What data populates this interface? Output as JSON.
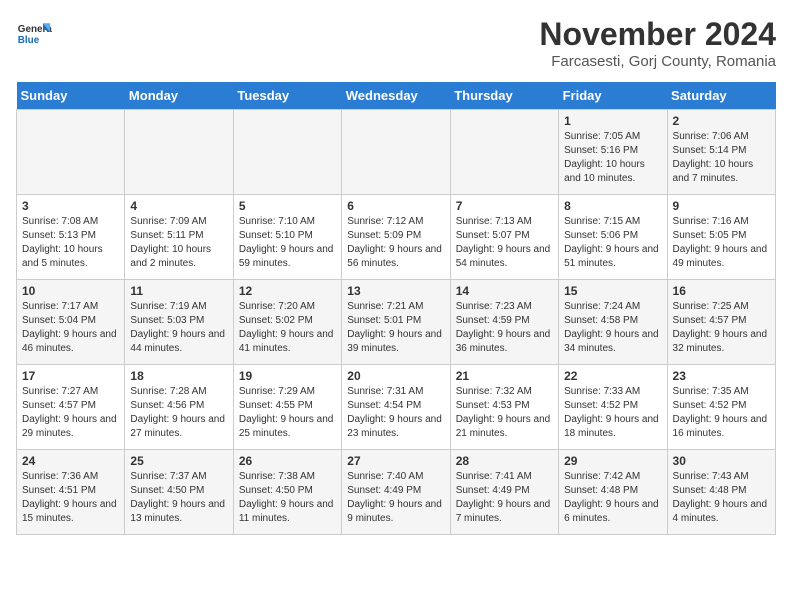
{
  "logo": {
    "text_general": "General",
    "text_blue": "Blue"
  },
  "header": {
    "month_year": "November 2024",
    "location": "Farcasesti, Gorj County, Romania"
  },
  "weekdays": [
    "Sunday",
    "Monday",
    "Tuesday",
    "Wednesday",
    "Thursday",
    "Friday",
    "Saturday"
  ],
  "weeks": [
    [
      {
        "day": "",
        "info": ""
      },
      {
        "day": "",
        "info": ""
      },
      {
        "day": "",
        "info": ""
      },
      {
        "day": "",
        "info": ""
      },
      {
        "day": "",
        "info": ""
      },
      {
        "day": "1",
        "info": "Sunrise: 7:05 AM\nSunset: 5:16 PM\nDaylight: 10 hours and 10 minutes."
      },
      {
        "day": "2",
        "info": "Sunrise: 7:06 AM\nSunset: 5:14 PM\nDaylight: 10 hours and 7 minutes."
      }
    ],
    [
      {
        "day": "3",
        "info": "Sunrise: 7:08 AM\nSunset: 5:13 PM\nDaylight: 10 hours and 5 minutes."
      },
      {
        "day": "4",
        "info": "Sunrise: 7:09 AM\nSunset: 5:11 PM\nDaylight: 10 hours and 2 minutes."
      },
      {
        "day": "5",
        "info": "Sunrise: 7:10 AM\nSunset: 5:10 PM\nDaylight: 9 hours and 59 minutes."
      },
      {
        "day": "6",
        "info": "Sunrise: 7:12 AM\nSunset: 5:09 PM\nDaylight: 9 hours and 56 minutes."
      },
      {
        "day": "7",
        "info": "Sunrise: 7:13 AM\nSunset: 5:07 PM\nDaylight: 9 hours and 54 minutes."
      },
      {
        "day": "8",
        "info": "Sunrise: 7:15 AM\nSunset: 5:06 PM\nDaylight: 9 hours and 51 minutes."
      },
      {
        "day": "9",
        "info": "Sunrise: 7:16 AM\nSunset: 5:05 PM\nDaylight: 9 hours and 49 minutes."
      }
    ],
    [
      {
        "day": "10",
        "info": "Sunrise: 7:17 AM\nSunset: 5:04 PM\nDaylight: 9 hours and 46 minutes."
      },
      {
        "day": "11",
        "info": "Sunrise: 7:19 AM\nSunset: 5:03 PM\nDaylight: 9 hours and 44 minutes."
      },
      {
        "day": "12",
        "info": "Sunrise: 7:20 AM\nSunset: 5:02 PM\nDaylight: 9 hours and 41 minutes."
      },
      {
        "day": "13",
        "info": "Sunrise: 7:21 AM\nSunset: 5:01 PM\nDaylight: 9 hours and 39 minutes."
      },
      {
        "day": "14",
        "info": "Sunrise: 7:23 AM\nSunset: 4:59 PM\nDaylight: 9 hours and 36 minutes."
      },
      {
        "day": "15",
        "info": "Sunrise: 7:24 AM\nSunset: 4:58 PM\nDaylight: 9 hours and 34 minutes."
      },
      {
        "day": "16",
        "info": "Sunrise: 7:25 AM\nSunset: 4:57 PM\nDaylight: 9 hours and 32 minutes."
      }
    ],
    [
      {
        "day": "17",
        "info": "Sunrise: 7:27 AM\nSunset: 4:57 PM\nDaylight: 9 hours and 29 minutes."
      },
      {
        "day": "18",
        "info": "Sunrise: 7:28 AM\nSunset: 4:56 PM\nDaylight: 9 hours and 27 minutes."
      },
      {
        "day": "19",
        "info": "Sunrise: 7:29 AM\nSunset: 4:55 PM\nDaylight: 9 hours and 25 minutes."
      },
      {
        "day": "20",
        "info": "Sunrise: 7:31 AM\nSunset: 4:54 PM\nDaylight: 9 hours and 23 minutes."
      },
      {
        "day": "21",
        "info": "Sunrise: 7:32 AM\nSunset: 4:53 PM\nDaylight: 9 hours and 21 minutes."
      },
      {
        "day": "22",
        "info": "Sunrise: 7:33 AM\nSunset: 4:52 PM\nDaylight: 9 hours and 18 minutes."
      },
      {
        "day": "23",
        "info": "Sunrise: 7:35 AM\nSunset: 4:52 PM\nDaylight: 9 hours and 16 minutes."
      }
    ],
    [
      {
        "day": "24",
        "info": "Sunrise: 7:36 AM\nSunset: 4:51 PM\nDaylight: 9 hours and 15 minutes."
      },
      {
        "day": "25",
        "info": "Sunrise: 7:37 AM\nSunset: 4:50 PM\nDaylight: 9 hours and 13 minutes."
      },
      {
        "day": "26",
        "info": "Sunrise: 7:38 AM\nSunset: 4:50 PM\nDaylight: 9 hours and 11 minutes."
      },
      {
        "day": "27",
        "info": "Sunrise: 7:40 AM\nSunset: 4:49 PM\nDaylight: 9 hours and 9 minutes."
      },
      {
        "day": "28",
        "info": "Sunrise: 7:41 AM\nSunset: 4:49 PM\nDaylight: 9 hours and 7 minutes."
      },
      {
        "day": "29",
        "info": "Sunrise: 7:42 AM\nSunset: 4:48 PM\nDaylight: 9 hours and 6 minutes."
      },
      {
        "day": "30",
        "info": "Sunrise: 7:43 AM\nSunset: 4:48 PM\nDaylight: 9 hours and 4 minutes."
      }
    ]
  ]
}
